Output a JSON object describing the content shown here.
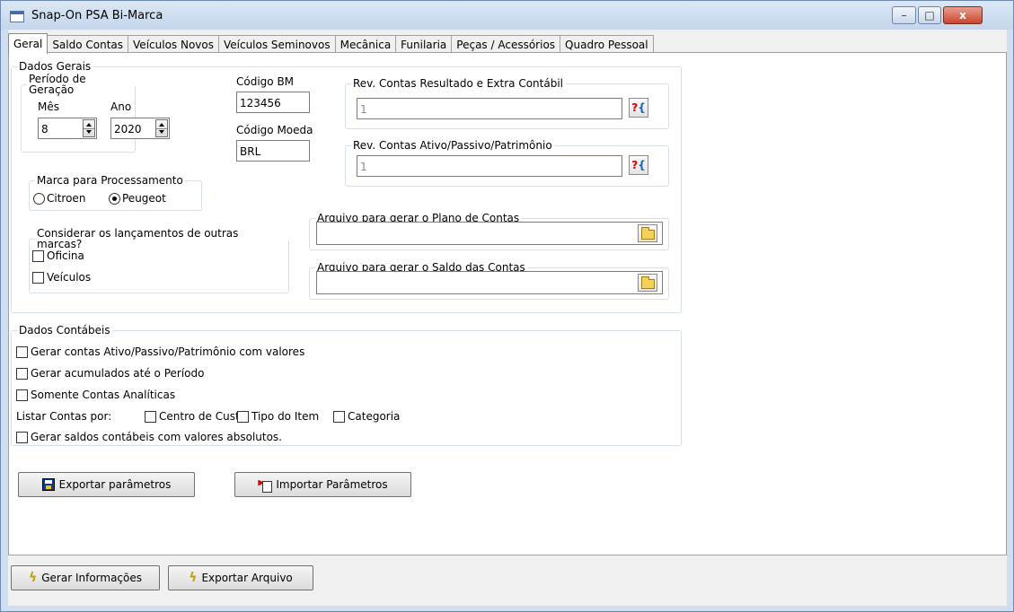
{
  "window": {
    "title": "Snap-On PSA Bi-Marca",
    "minimize_glyph": "–",
    "maximize_glyph": "□",
    "close_glyph": "x"
  },
  "tabs": [
    {
      "label": "Geral",
      "active": true
    },
    {
      "label": "Saldo Contas",
      "active": false
    },
    {
      "label": "Veículos Novos",
      "active": false
    },
    {
      "label": "Veículos Seminovos",
      "active": false
    },
    {
      "label": "Mecânica",
      "active": false
    },
    {
      "label": "Funilaria",
      "active": false
    },
    {
      "label": "Peças / Acessórios",
      "active": false
    },
    {
      "label": "Quadro Pessoal",
      "active": false
    }
  ],
  "dados_gerais": {
    "legend": "Dados Gerais",
    "periodo": {
      "legend": "Período de Geração",
      "mes_label": "Mês",
      "mes_value": "8",
      "ano_label": "Ano",
      "ano_value": "2020"
    },
    "codigo_bm": {
      "label": "Código BM",
      "value": "123456"
    },
    "codigo_moeda": {
      "label": "Código Moeda",
      "value": "BRL"
    },
    "rev_resultado": {
      "legend": "Rev. Contas Resultado e Extra Contábil",
      "value": "1"
    },
    "rev_ativo": {
      "legend": "Rev. Contas Ativo/Passivo/Patrimônio",
      "value": "1"
    },
    "marca": {
      "legend": "Marca para Processamento",
      "options": [
        {
          "label": "Citroen",
          "selected": false
        },
        {
          "label": "Peugeot",
          "selected": true
        }
      ]
    },
    "outras_marcas": {
      "legend": "Considerar os lançamentos de outras marcas?",
      "options": [
        {
          "label": "Oficina",
          "checked": false
        },
        {
          "label": "Veículos",
          "checked": false
        }
      ]
    },
    "arquivo_plano": {
      "legend": "Arquivo para gerar o Plano de Contas",
      "value": ""
    },
    "arquivo_saldo": {
      "legend": "Arquivo para gerar o Saldo das Contas",
      "value": ""
    }
  },
  "dados_contabeis": {
    "legend": "Dados Contábeis",
    "options": [
      {
        "label": "Gerar contas Ativo/Passivo/Patrimônio com valores",
        "checked": false
      },
      {
        "label": "Gerar acumulados até o Período",
        "checked": false
      },
      {
        "label": "Somente Contas Analíticas",
        "checked": false
      }
    ],
    "listar_label": "Listar Contas por:",
    "listar_options": [
      {
        "label": "Centro de Custo",
        "checked": false
      },
      {
        "label": "Tipo do Item",
        "checked": false
      },
      {
        "label": "Categoria",
        "checked": false
      }
    ],
    "absolutos_label": "Gerar saldos contábeis com valores absolutos."
  },
  "buttons": {
    "exportar_parametros": "Exportar parâmetros",
    "importar_parametros": "Importar Parâmetros",
    "gerar_informacoes": "Gerar Informações",
    "exportar_arquivo": "Exportar Arquivo"
  }
}
